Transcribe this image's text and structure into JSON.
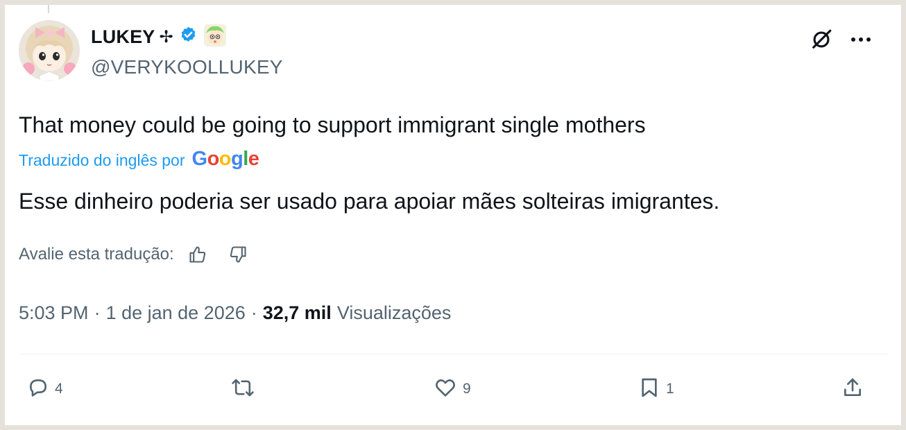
{
  "tweet": {
    "author": {
      "display_name": "LUKEY",
      "name_symbol": "✢",
      "handle": "@VERYKOOLLUKEY",
      "verified_icon": "verified-badge-icon",
      "badge_emoji": "green-haired-character-emoji"
    },
    "text": "That money could be going to support immigrant single mothers",
    "translation": {
      "label": "Traduzido do inglês por",
      "provider": "Google",
      "text": "Esse dinheiro poderia ser usado para apoiar mães solteiras imigrantes.",
      "rate_label": "Avalie esta tradução:"
    },
    "meta": {
      "time": "5:03 PM",
      "date": "1 de jan de 2026",
      "views_count": "32,7 mil",
      "views_label": "Visualizações",
      "separator": "·"
    },
    "actions": {
      "replies": "4",
      "reposts": "",
      "likes": "9",
      "bookmarks": "1"
    }
  },
  "colors": {
    "accent": "#1d9bf0",
    "text_primary": "#0f1419",
    "text_secondary": "#536471",
    "frame_background": "#e6e1da"
  },
  "icons": {
    "header_right": [
      "grok-icon",
      "more-icon"
    ],
    "actions": [
      "reply-icon",
      "repost-icon",
      "like-icon",
      "bookmark-icon",
      "share-icon"
    ]
  }
}
